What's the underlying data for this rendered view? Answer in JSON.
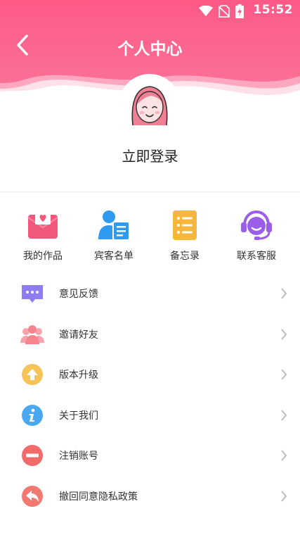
{
  "status_bar": {
    "time": "15:52",
    "icons": [
      "wifi-icon",
      "no-sim-icon",
      "battery-charging-icon"
    ]
  },
  "header": {
    "title": "个人中心",
    "back_icon": "back-chevron-icon",
    "bg_color": "#fd5f88"
  },
  "profile": {
    "login_label": "立即登录",
    "avatar_icon": "girl-avatar-icon"
  },
  "quick_actions": [
    {
      "label": "我的作品",
      "icon": "heart-envelope-icon",
      "color": "#f2587b"
    },
    {
      "label": "宾客名单",
      "icon": "guest-card-icon",
      "color": "#2e9bf0"
    },
    {
      "label": "备忘录",
      "icon": "memo-list-icon",
      "color": "#f6b73c"
    },
    {
      "label": "联系客服",
      "icon": "customer-service-headset-icon",
      "color": "#9b5ee8"
    }
  ],
  "menu": [
    {
      "label": "意见反馈",
      "icon": "feedback-chat-icon",
      "color": "#8e7cf0"
    },
    {
      "label": "邀请好友",
      "icon": "invite-friends-icon",
      "color": "#f5848f"
    },
    {
      "label": "版本升级",
      "icon": "upgrade-arrow-icon",
      "color": "#f6c35a"
    },
    {
      "label": "关于我们",
      "icon": "info-icon",
      "color": "#4aa8f0"
    },
    {
      "label": "注销账号",
      "icon": "cancel-account-icon",
      "color": "#f26a6a"
    },
    {
      "label": "撤回同意隐私政策",
      "icon": "revoke-undo-icon",
      "color": "#f2796f"
    }
  ]
}
